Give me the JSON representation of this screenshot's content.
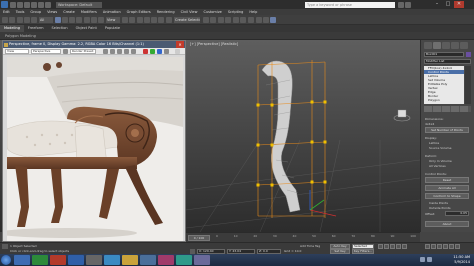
{
  "titlebar": {
    "workspace": "Workspace: Default",
    "search_placeholder": "Type a keyword or phrase",
    "minimize": "–",
    "maximize": "□",
    "close": "✕"
  },
  "menu": [
    "Edit",
    "Tools",
    "Group",
    "Views",
    "Create",
    "Modifiers",
    "Animation",
    "Graph Editors",
    "Rendering",
    "Civil View",
    "Customize",
    "Scripting",
    "Help"
  ],
  "toolbar": {
    "filter_value": "All",
    "view_value": "View",
    "selection_set": "Create Selection Se"
  },
  "ribbon": {
    "tabs": [
      "Modeling",
      "Freeform",
      "Selection",
      "Object Paint",
      "Populate"
    ],
    "active": "Modeling",
    "sub_tabs": [
      "Polygon Modeling"
    ]
  },
  "viewport": {
    "label": "[+] [Perspective] [Realistic]",
    "colors": {
      "model": "#d9d9d9",
      "cage": "#e88b1a",
      "grid": "#808080"
    }
  },
  "render_window": {
    "title": "Perspective, frame 0, Display Gamma: 2.2, RGBA Color 16 Bits/Channel (1:1)",
    "area_label": "Area to Render",
    "area_value": "View",
    "viewport_value": "Perspective",
    "preset_value": "Render Preset:"
  },
  "command_panel": {
    "object_name": "Box001",
    "modifier_list": "Modifier List",
    "stack": [
      "FFD(box) 4x4x4",
      "Control Points",
      "Lattice",
      "Set Volume",
      "Editable Poly",
      "Vertex",
      "Edge",
      "Border",
      "Polygon"
    ],
    "selected_index": 1,
    "sections": {
      "dimensions": "Dimensions:",
      "dims_value": "4x4x4",
      "set_points": "Set Number of Points",
      "display": "Display:",
      "lattice": "Lattice",
      "source_volume": "Source Volume",
      "deform": "Deform:",
      "only_in_volume": "Only In Volume",
      "all_vertices": "All Vertices",
      "control_points": "Control Points:",
      "reset": "Reset",
      "animate_all": "Animate All",
      "conform": "Conform to Shape",
      "inside_points": "Inside Points",
      "outside_points": "Outside Points",
      "offset_label": "Offset:",
      "offset": "0.05",
      "about": "About"
    }
  },
  "timeline": {
    "frame_counter": "0 / 100",
    "ticks": [
      "0",
      "10",
      "20",
      "30",
      "40",
      "50",
      "60",
      "70",
      "80",
      "90",
      "100"
    ]
  },
  "status": {
    "selected": "1 Object Selected",
    "prompt": "Click or click-and-drag to select objects",
    "x": "X: 129.40",
    "y": "Y: 43.04",
    "z": "Z: 0.0",
    "grid": "Grid = 10.0",
    "auto_key": "Auto Key",
    "selected_dd": "Selected",
    "set_key": "Set Key",
    "key_filters": "Key Filters...",
    "add_time_tag": "Add Time Tag"
  },
  "taskbar": {
    "time": "11:50 AM",
    "date": "5/9/2014"
  }
}
